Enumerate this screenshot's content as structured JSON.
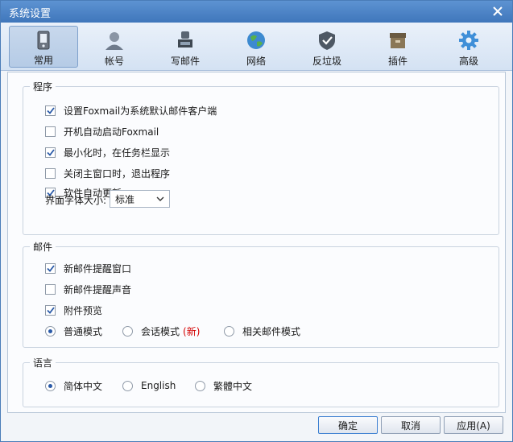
{
  "window": {
    "title": "系统设置"
  },
  "tabs": [
    {
      "label": "常用",
      "icon": "phone-icon",
      "active": true
    },
    {
      "label": "帐号",
      "icon": "user-icon",
      "active": false
    },
    {
      "label": "写邮件",
      "icon": "write-mail-icon",
      "active": false
    },
    {
      "label": "网络",
      "icon": "globe-icon",
      "active": false
    },
    {
      "label": "反垃圾",
      "icon": "shield-icon",
      "active": false
    },
    {
      "label": "插件",
      "icon": "box-icon",
      "active": false
    },
    {
      "label": "高级",
      "icon": "gear-icon",
      "active": false
    }
  ],
  "program": {
    "title": "程序",
    "options": [
      {
        "label": "设置Foxmail为系统默认邮件客户端",
        "checked": true
      },
      {
        "label": "开机自动启动Foxmail",
        "checked": false
      },
      {
        "label": "最小化时，在任务栏显示",
        "checked": true
      },
      {
        "label": "关闭主窗口时，退出程序",
        "checked": false
      },
      {
        "label": "软件自动更新",
        "checked": true
      }
    ],
    "font_size_label": "界面字体大小:",
    "font_size_value": "标准"
  },
  "mail": {
    "title": "邮件",
    "options": [
      {
        "label": "新邮件提醒窗口",
        "checked": true
      },
      {
        "label": "新邮件提醒声音",
        "checked": false
      },
      {
        "label": "附件预览",
        "checked": true
      }
    ],
    "modes": [
      {
        "label": "普通模式",
        "selected": true
      },
      {
        "label": "会话模式",
        "selected": false
      },
      {
        "label": "相关邮件模式",
        "selected": false
      }
    ],
    "new_tag": "(新)"
  },
  "language": {
    "title": "语言",
    "options": [
      {
        "label": "简体中文",
        "selected": true
      },
      {
        "label": "English",
        "selected": false
      },
      {
        "label": "繁體中文",
        "selected": false
      }
    ]
  },
  "buttons": {
    "ok": "确定",
    "cancel": "取消",
    "apply": "应用(A)"
  },
  "colors": {
    "accent": "#3f76bb",
    "check": "#2a5aa8",
    "annotation_arrow": "#e8283a"
  }
}
